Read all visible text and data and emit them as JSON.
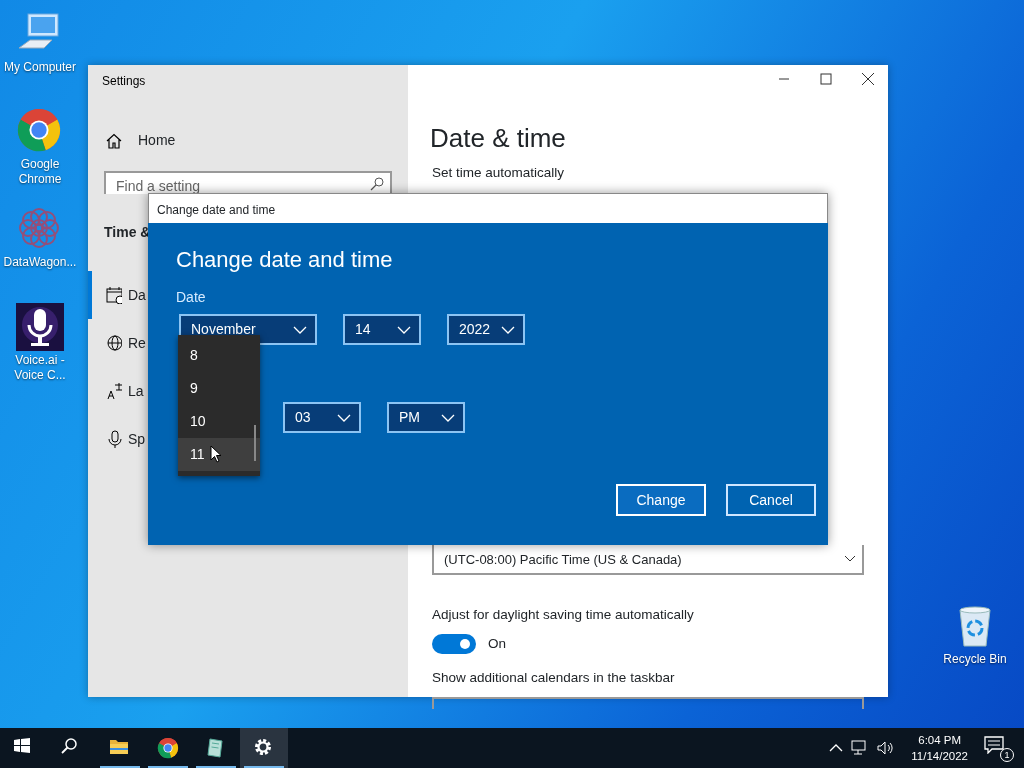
{
  "desktop_icons": [
    {
      "kind": "computer",
      "label": "My Computer"
    },
    {
      "kind": "chrome",
      "label": "Google Chrome"
    },
    {
      "kind": "flower",
      "label": "DataWagon..."
    },
    {
      "kind": "mic",
      "label": "Voice.ai - Voice C..."
    },
    {
      "kind": "bin",
      "label": "Recycle Bin"
    }
  ],
  "settings_window": {
    "title": "Settings",
    "sidebar": {
      "home": "Home",
      "search": {
        "placeholder": "Find a setting"
      },
      "section": "Time &",
      "items": [
        {
          "kind": "calendar",
          "label": "Da",
          "selected": true
        },
        {
          "kind": "globe",
          "label": "Re",
          "selected": false
        },
        {
          "kind": "language",
          "label": "La",
          "selected": false
        },
        {
          "kind": "mic",
          "label": "Sp",
          "selected": false
        }
      ]
    },
    "content": {
      "heading": "Date & time",
      "set_time_automatically": "Set time automatically",
      "time_zone": "(UTC-08:00) Pacific Time (US & Canada)",
      "daylight_saving": {
        "label": "Adjust for daylight saving time automatically",
        "on": true,
        "state_text": "On"
      },
      "calendars_label": "Show additional calendars in the taskbar"
    }
  },
  "dialog": {
    "title": "Change date and time",
    "heading": "Change date and time",
    "date_label": "Date",
    "date_fields": [
      {
        "value": "November"
      },
      {
        "value": "14"
      },
      {
        "value": "2022"
      }
    ],
    "time_fields": [
      {
        "value": "03"
      },
      {
        "value": "PM"
      }
    ],
    "hour_list": [
      {
        "label": "8",
        "selected": false
      },
      {
        "label": "9",
        "selected": false
      },
      {
        "label": "10",
        "selected": false
      },
      {
        "label": "11",
        "selected": true
      }
    ],
    "buttons": [
      {
        "label": "Change",
        "focused": true
      },
      {
        "label": "Cancel",
        "focused": false
      }
    ]
  },
  "taskbar": {
    "apps": [
      {
        "kind": "start",
        "running": false,
        "active": false
      },
      {
        "kind": "search",
        "running": false,
        "active": false
      },
      {
        "kind": "folder",
        "running": true,
        "active": false
      },
      {
        "kind": "chrome",
        "running": true,
        "active": false
      },
      {
        "kind": "notepad",
        "running": true,
        "active": false
      },
      {
        "kind": "gear",
        "running": true,
        "active": true
      }
    ],
    "time": "6:04 PM",
    "date": "11/14/2022",
    "notifications": "1"
  }
}
